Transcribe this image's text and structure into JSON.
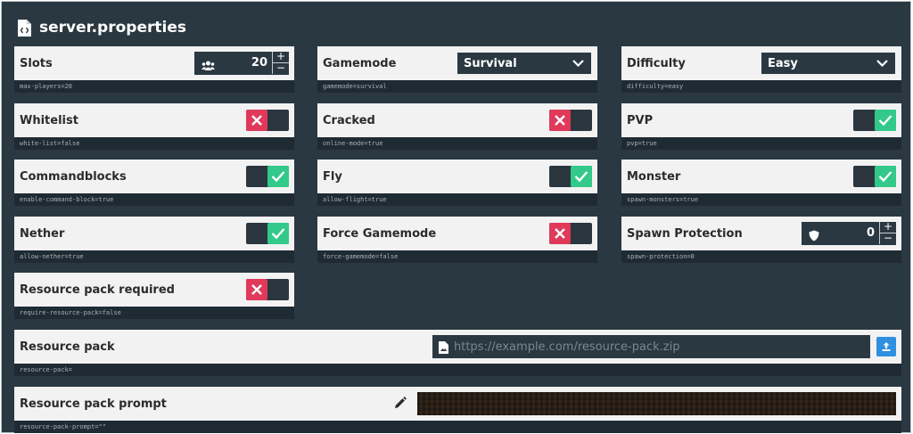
{
  "header": {
    "title": "server.properties",
    "icon": "file-code-icon"
  },
  "colors": {
    "background": "#2a3842",
    "row": "#f2f2f2",
    "toggle_on": "#32c98a",
    "toggle_off": "#e0395a",
    "upload": "#2f8fe0"
  },
  "fields": {
    "slots": {
      "label": "Slots",
      "key": "max-players=20",
      "value": "20",
      "icon": "users-icon"
    },
    "gamemode": {
      "label": "Gamemode",
      "key": "gamemode=survival",
      "value": "Survival"
    },
    "difficulty": {
      "label": "Difficulty",
      "key": "difficulty=easy",
      "value": "Easy"
    },
    "whitelist": {
      "label": "Whitelist",
      "key": "white-list=false",
      "on": false
    },
    "cracked": {
      "label": "Cracked",
      "key": "online-mode=true",
      "on": false
    },
    "pvp": {
      "label": "PVP",
      "key": "pvp=true",
      "on": true
    },
    "commandblocks": {
      "label": "Commandblocks",
      "key": "enable-command-block=true",
      "on": true
    },
    "fly": {
      "label": "Fly",
      "key": "allow-flight=true",
      "on": true
    },
    "monster": {
      "label": "Monster",
      "key": "spawn-monsters=true",
      "on": true
    },
    "nether": {
      "label": "Nether",
      "key": "allow-nether=true",
      "on": true
    },
    "force_gamemode": {
      "label": "Force Gamemode",
      "key": "force-gamemode=false",
      "on": false
    },
    "spawn_protection": {
      "label": "Spawn Protection",
      "key": "spawn-protection=0",
      "value": "0",
      "icon": "shield-icon"
    },
    "resource_pack_required": {
      "label": "Resource pack required",
      "key": "require-resource-pack=false",
      "on": false
    },
    "resource_pack": {
      "label": "Resource pack",
      "key": "resource-pack=",
      "placeholder": "https://example.com/resource-pack.zip",
      "value": ""
    },
    "resource_pack_prompt": {
      "label": "Resource pack prompt",
      "key": "resource-pack-prompt=\"\""
    }
  }
}
